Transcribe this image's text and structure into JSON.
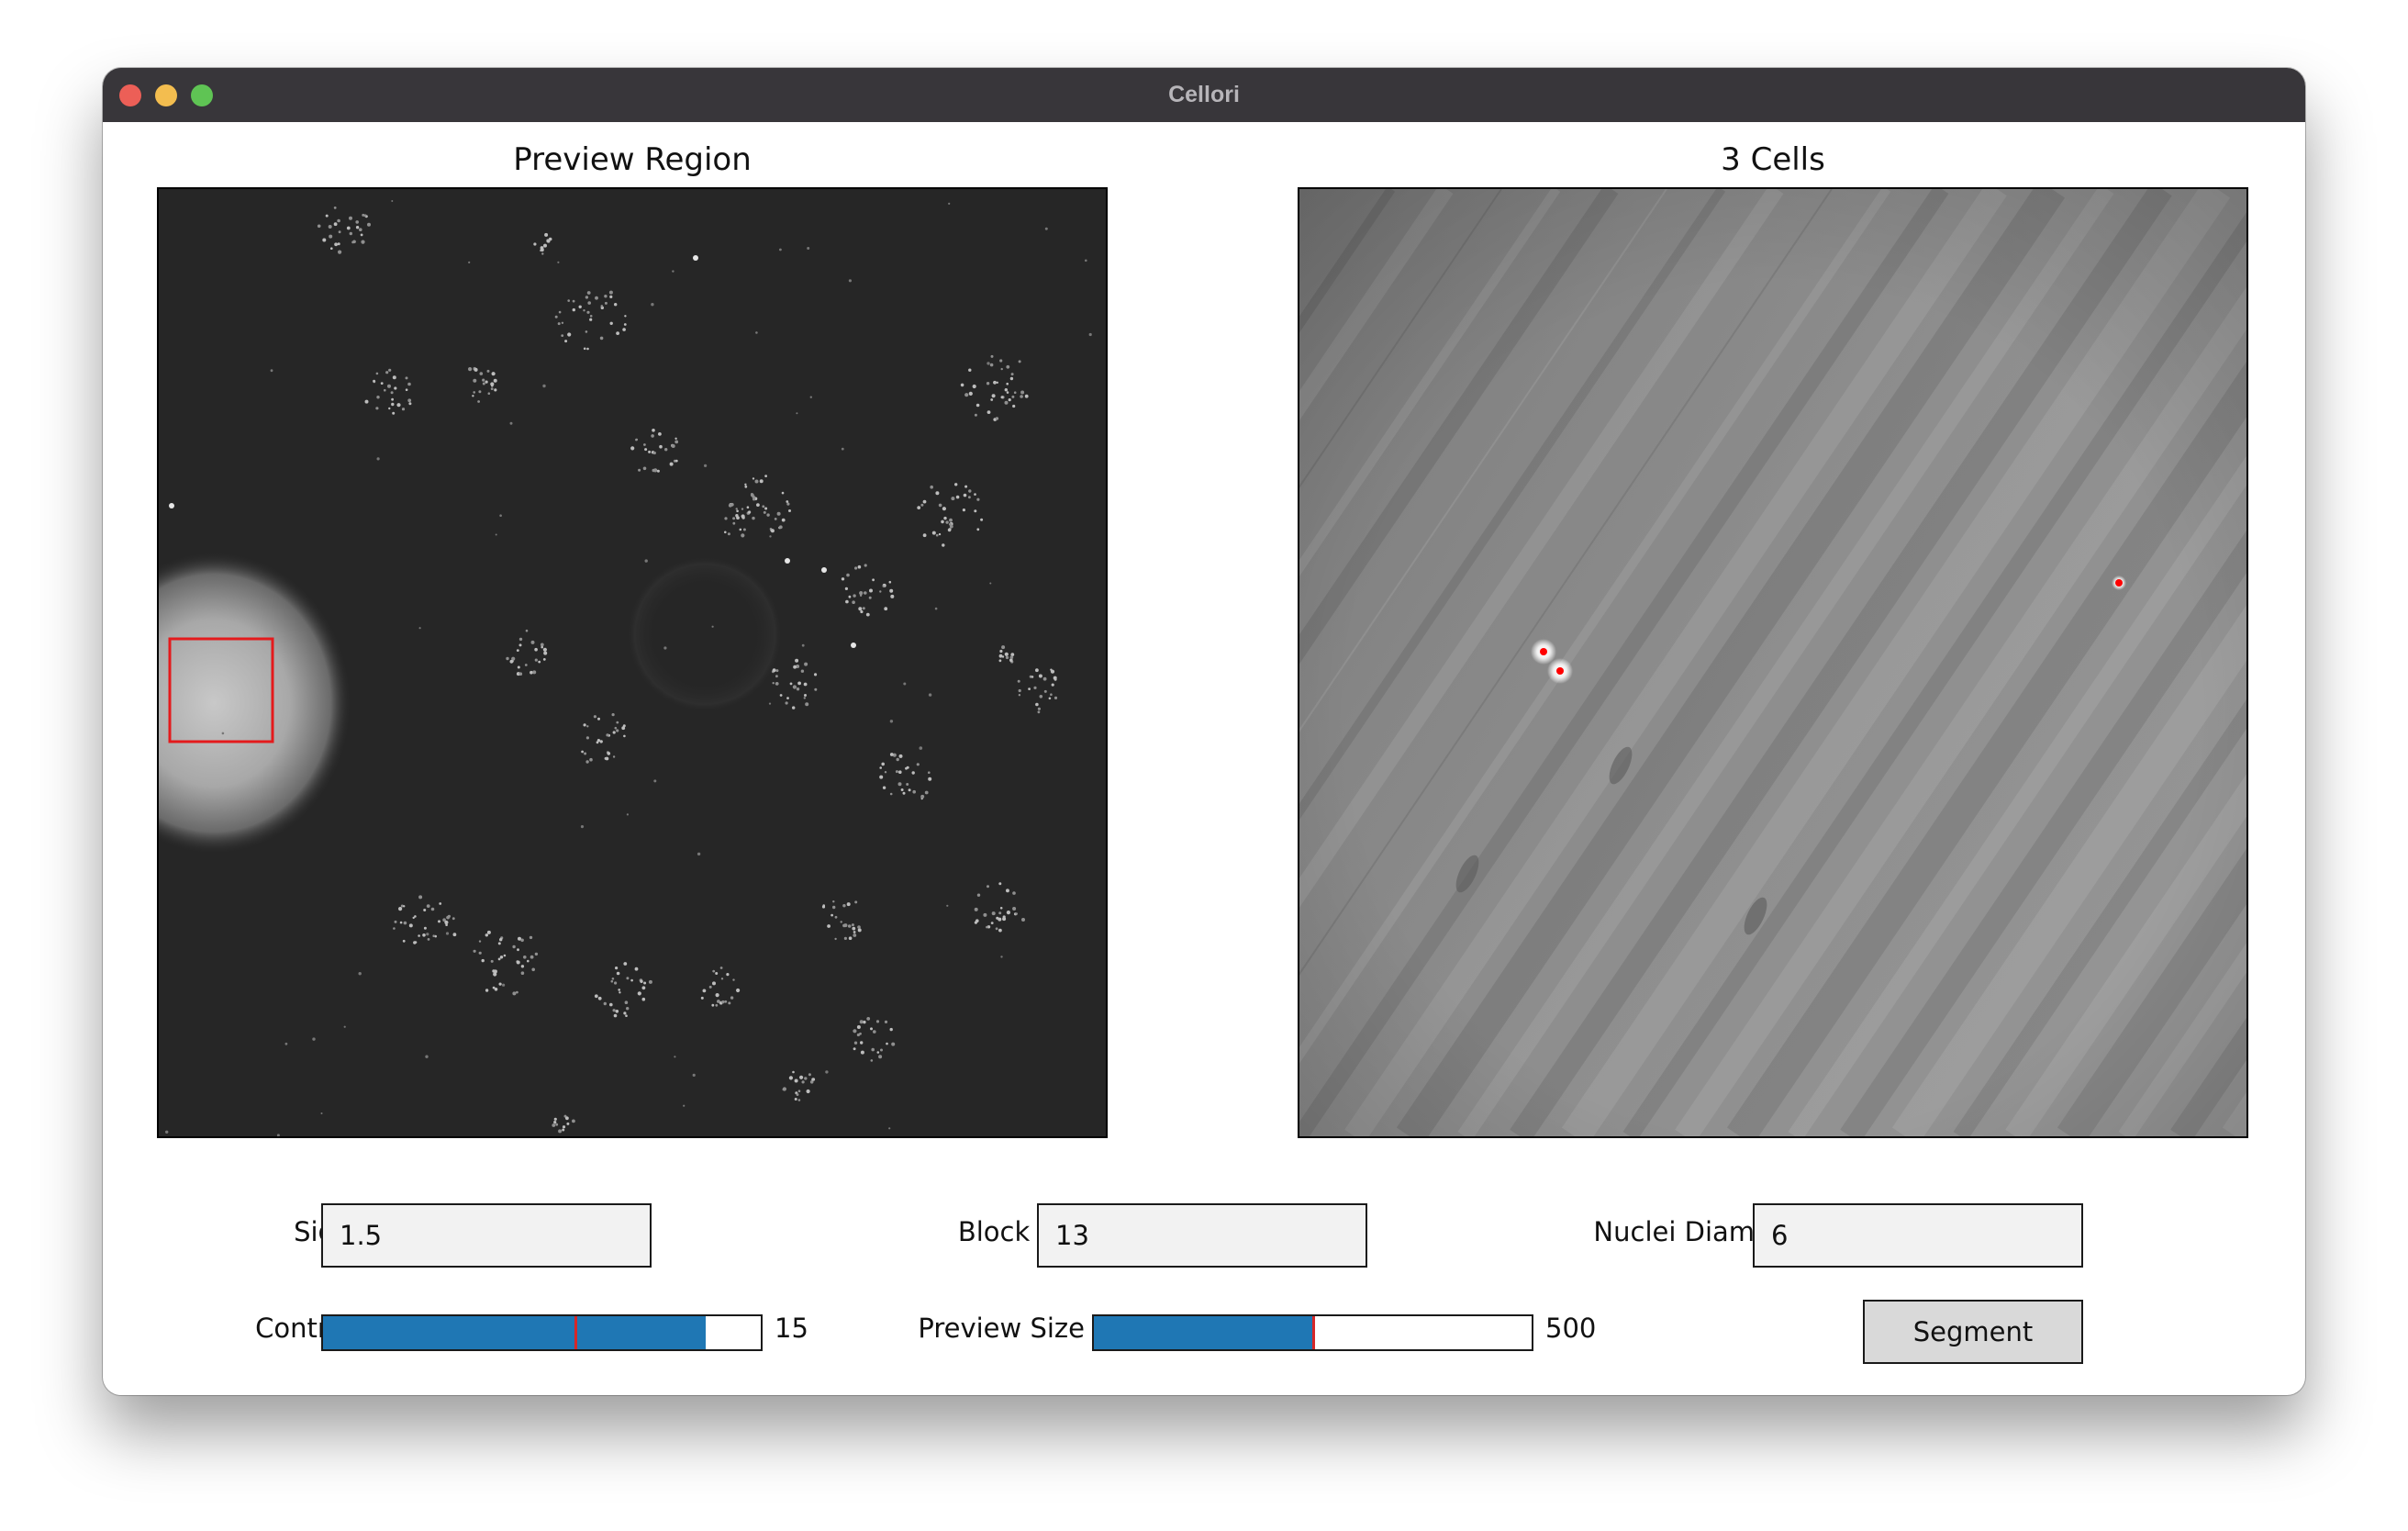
{
  "window": {
    "title": "Cellori"
  },
  "left_panel": {
    "title": "Preview Region"
  },
  "right_panel": {
    "title": "3 Cells"
  },
  "controls": {
    "sigma": {
      "label": "Sigma",
      "value": "1.5"
    },
    "block_size": {
      "label": "Block Size",
      "value": "13"
    },
    "nuclei_diameter": {
      "label": "Nuclei Diameter",
      "value": "6"
    },
    "contrast": {
      "label": "Contrast",
      "value_text": "15",
      "fill_fraction": 0.875,
      "marker_fraction": 0.575
    },
    "preview_size": {
      "label": "Preview Size",
      "value_text": "500",
      "fill_fraction": 0.5
    },
    "segment_button": {
      "label": "Segment"
    }
  },
  "colors": {
    "slider_fill": "#1f77b4",
    "slider_marker": "#d62728",
    "selection_box": "#e41a1c",
    "detected_cell": "#ff0000"
  }
}
